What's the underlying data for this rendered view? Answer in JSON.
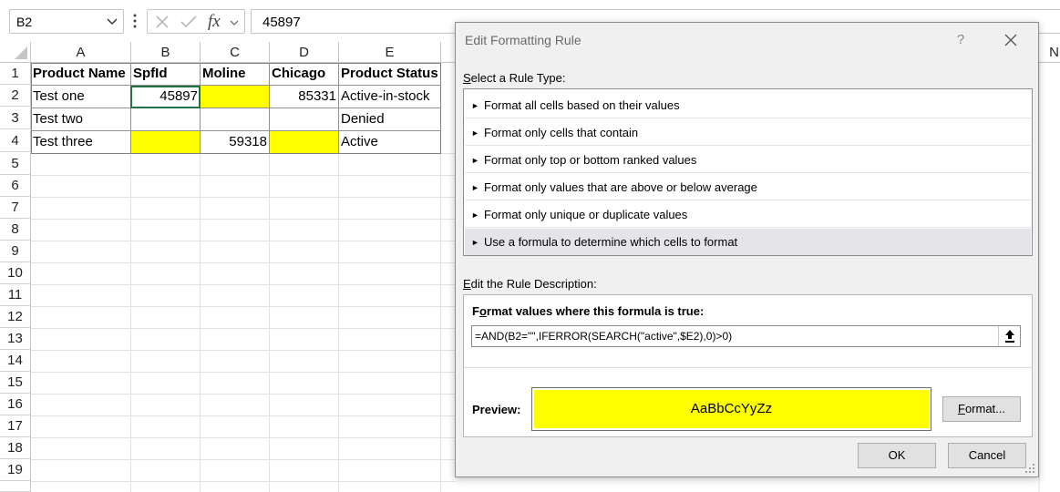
{
  "formula_bar": {
    "name_box": "B2",
    "fx_symbol": "fx",
    "content": "45897"
  },
  "sheet": {
    "columns": [
      "A",
      "B",
      "C",
      "D",
      "E",
      "N"
    ],
    "rows": [
      "1",
      "2",
      "3",
      "4",
      "5",
      "6",
      "7",
      "8",
      "9",
      "10",
      "11",
      "12",
      "13",
      "14",
      "15",
      "16",
      "17",
      "18",
      "19"
    ],
    "cells": {
      "A1": "Product Name",
      "B1": "SpfId",
      "C1": "Moline",
      "D1": "Chicago",
      "E1": "Product Status",
      "A2": "Test one",
      "B2": "45897",
      "C2": "",
      "D2": "85331",
      "E2": "Active-in-stock",
      "A3": "Test two",
      "B3": "",
      "C3": "",
      "D3": "",
      "E3": "Denied",
      "A4": "Test three",
      "B4": "",
      "C4": "59318",
      "D4": "",
      "E4": "Active"
    },
    "highlight_color": "#ffff00",
    "selection_color": "#217346"
  },
  "dialog": {
    "title": "Edit Formatting Rule",
    "help": "?",
    "select_rule_label_u": "S",
    "select_rule_label_rest": "elect a Rule Type:",
    "rule_types": [
      "Format all cells based on their values",
      "Format only cells that contain",
      "Format only top or bottom ranked values",
      "Format only values that are above or below average",
      "Format only unique or duplicate values",
      "Use a formula to determine which cells to format"
    ],
    "selected_rule_index": 5,
    "edit_desc_u": "E",
    "edit_desc_rest": "dit the Rule Description:",
    "formula_label_pre": "F",
    "formula_label_u": "o",
    "formula_label_rest": "rmat values where this formula is true:",
    "formula": "=AND(B2=\"\",IFERROR(SEARCH(\"active\",$E2),0)>0)",
    "preview_label": "Preview:",
    "preview_text": "AaBbCcYyZz",
    "format_button_u": "F",
    "format_button_rest": "ormat...",
    "ok": "OK",
    "cancel": "Cancel"
  }
}
